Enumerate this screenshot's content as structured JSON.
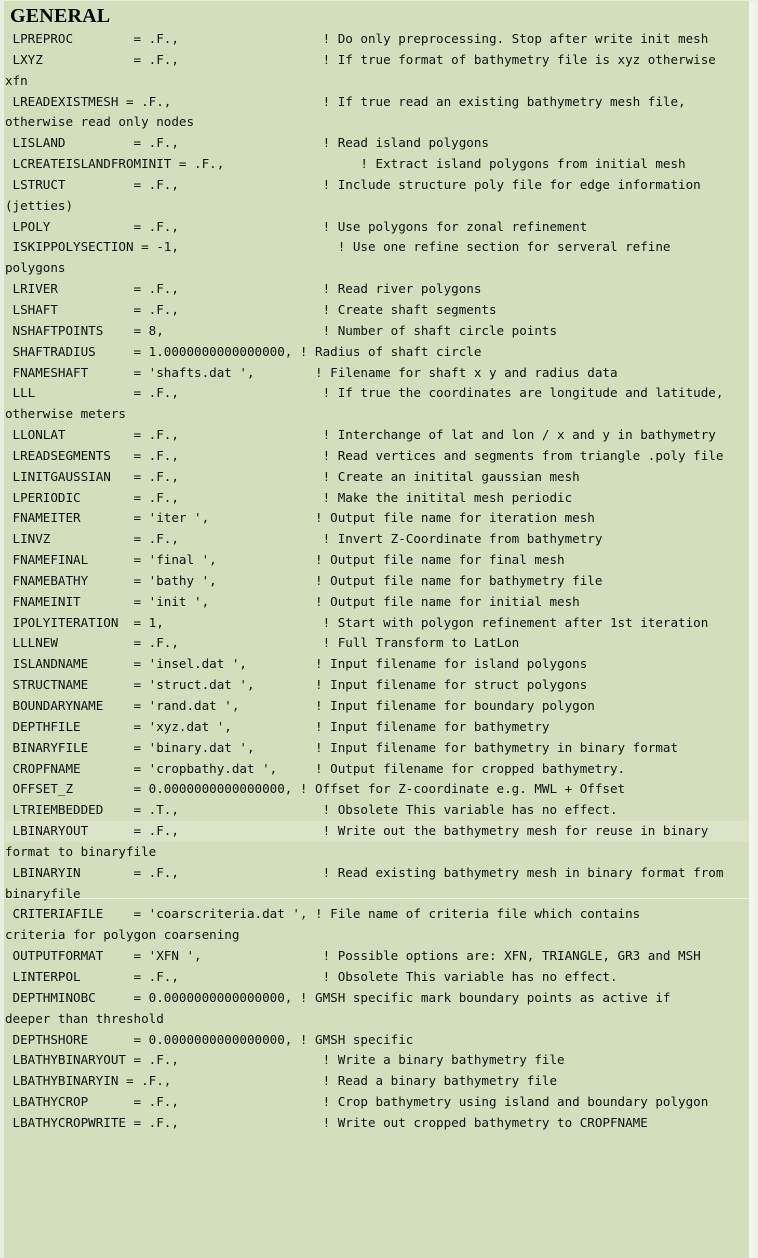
{
  "document": {
    "section_heading": "GENERAL",
    "background_color": "#d3debd",
    "text_color": "#111111",
    "format": "fortran-namelist-listing"
  },
  "listing": {
    "lines": [
      " LPREPROC        = .F.,                   ! Do only preprocessing. Stop after write init mesh",
      " LXYZ            = .F.,                   ! If true format of bathymetry file is xyz otherwise",
      "xfn",
      " LREADEXISTMESH = .F.,                    ! If true read an existing bathymetry mesh file,",
      "otherwise read only nodes",
      " LISLAND         = .F.,                   ! Read island polygons",
      " LCREATEISLANDFROMINIT = .F.,                  ! Extract island polygons from initial mesh",
      " LSTRUCT         = .F.,                   ! Include structure poly file for edge information",
      "(jetties)",
      " LPOLY           = .F.,                   ! Use polygons for zonal refinement",
      " ISKIPPOLYSECTION = -1,                     ! Use one refine section for serveral refine",
      "polygons",
      " LRIVER          = .F.,                   ! Read river polygons",
      " LSHAFT          = .F.,                   ! Create shaft segments",
      " NSHAFTPOINTS    = 8,                     ! Number of shaft circle points",
      " SHAFTRADIUS     = 1.0000000000000000, ! Radius of shaft circle",
      " FNAMESHAFT      = 'shafts.dat ',        ! Filename for shaft x y and radius data",
      " LLL             = .F.,                   ! If true the coordinates are longitude and latitude,",
      "otherwise meters",
      " LLONLAT         = .F.,                   ! Interchange of lat and lon / x and y in bathymetry",
      " LREADSEGMENTS   = .F.,                   ! Read vertices and segments from triangle .poly file",
      " LINITGAUSSIAN   = .F.,                   ! Create an initital gaussian mesh",
      " LPERIODIC       = .F.,                   ! Make the initital mesh periodic",
      " FNAMEITER       = 'iter ',              ! Output file name for iteration mesh",
      " LINVZ           = .F.,                   ! Invert Z-Coordinate from bathymetry",
      " FNAMEFINAL      = 'final ',             ! Output file name for final mesh",
      " FNAMEBATHY      = 'bathy ',             ! Output file name for bathymetry file",
      " FNAMEINIT       = 'init ',              ! Output file name for initial mesh",
      " IPOLYITERATION  = 1,                     ! Start with polygon refinement after 1st iteration",
      " LLLNEW          = .F.,                   ! Full Transform to LatLon",
      " ISLANDNAME      = 'insel.dat ',         ! Input filename for island polygons",
      " STRUCTNAME      = 'struct.dat ',        ! Input filename for struct polygons",
      " BOUNDARYNAME    = 'rand.dat ',          ! Input filename for boundary polygon",
      " DEPTHFILE       = 'xyz.dat ',           ! Input filename for bathymetry",
      " BINARYFILE      = 'binary.dat ',        ! Input filename for bathymetry in binary format",
      " CROPFNAME       = 'cropbathy.dat ',     ! Output filename for cropped bathymetry.",
      " OFFSET_Z        = 0.0000000000000000, ! Offset for Z-coordinate e.g. MWL + Offset",
      " LTRIEMBEDDED    = .T.,                   ! Obsolete This variable has no effect.",
      " LBINARYOUT      = .F.,                   ! Write out the bathymetry mesh for reuse in binary",
      "format to binaryfile",
      " LBINARYIN       = .F.,                   ! Read existing bathymetry mesh in binary format from",
      "binaryfile",
      " CRITERIAFILE    = 'coarscriteria.dat ', ! File name of criteria file which contains",
      "criteria for polygon coarsening",
      " OUTPUTFORMAT    = 'XFN ',                ! Possible options are: XFN, TRIANGLE, GR3 and MSH",
      " LINTERPOL       = .F.,                   ! Obsolete This variable has no effect.",
      " DEPTHMINOBC     = 0.0000000000000000, ! GMSH specific mark boundary points as active if",
      "deeper than threshold",
      " DEPTHSHORE      = 0.0000000000000000, ! GMSH specific",
      " LBATHYBINARYOUT = .F.,                   ! Write a binary bathymetry file",
      " LBATHYBINARYIN = .F.,                    ! Read a binary bathymetry file",
      " LBATHYCROP      = .F.,                   ! Crop bathymetry using island and boundary polygon",
      " LBATHYCROPWRITE = .F.,                   ! Write out cropped bathymetry to CROPFNAME"
    ]
  }
}
